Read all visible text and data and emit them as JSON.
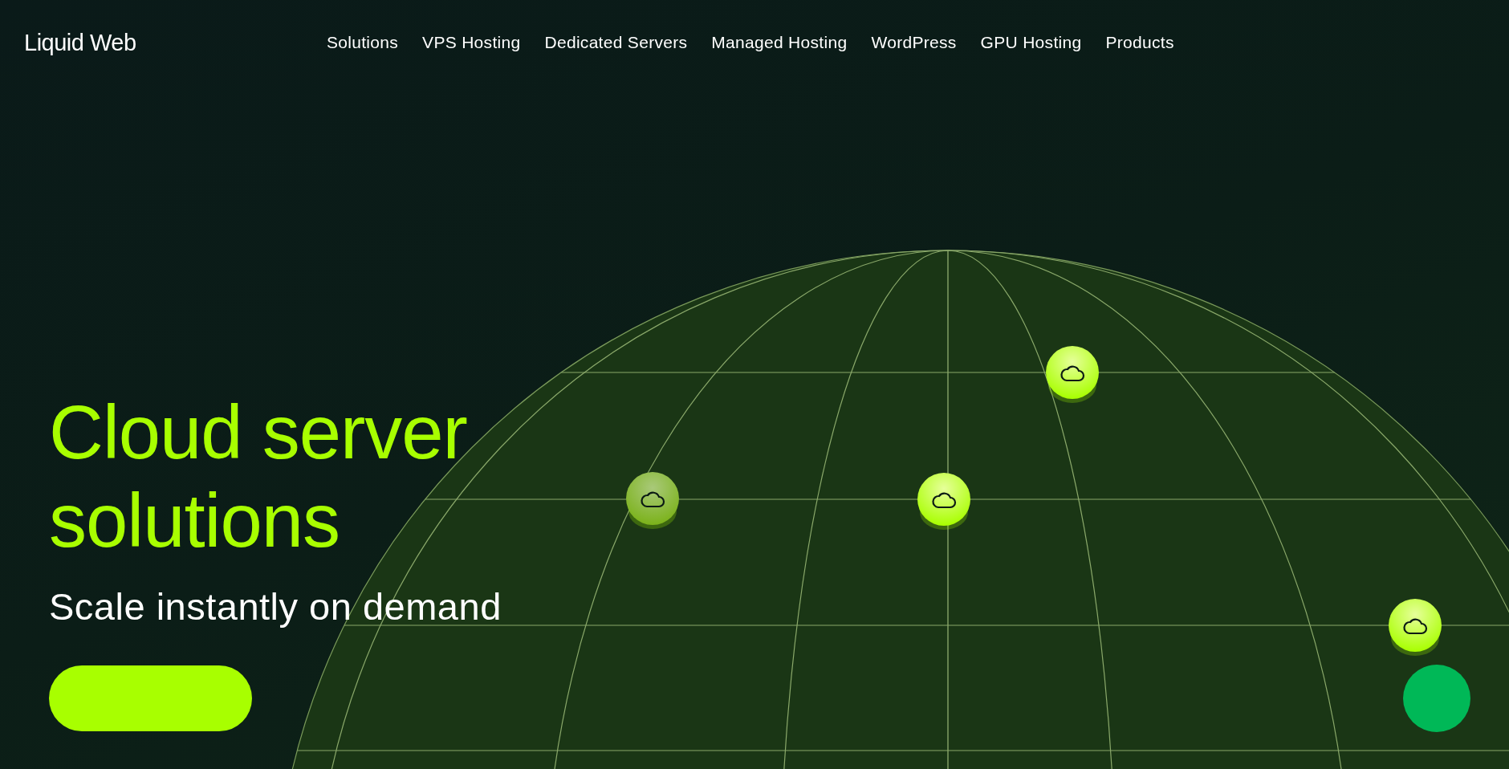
{
  "header": {
    "logo": "Liquid Web",
    "nav": [
      "Solutions",
      "VPS Hosting",
      "Dedicated Servers",
      "Managed Hosting",
      "WordPress",
      "GPU Hosting",
      "Products"
    ]
  },
  "hero": {
    "title_lines": [
      "Cloud server",
      "solutions"
    ],
    "subtitle": "Scale instantly on demand"
  }
}
